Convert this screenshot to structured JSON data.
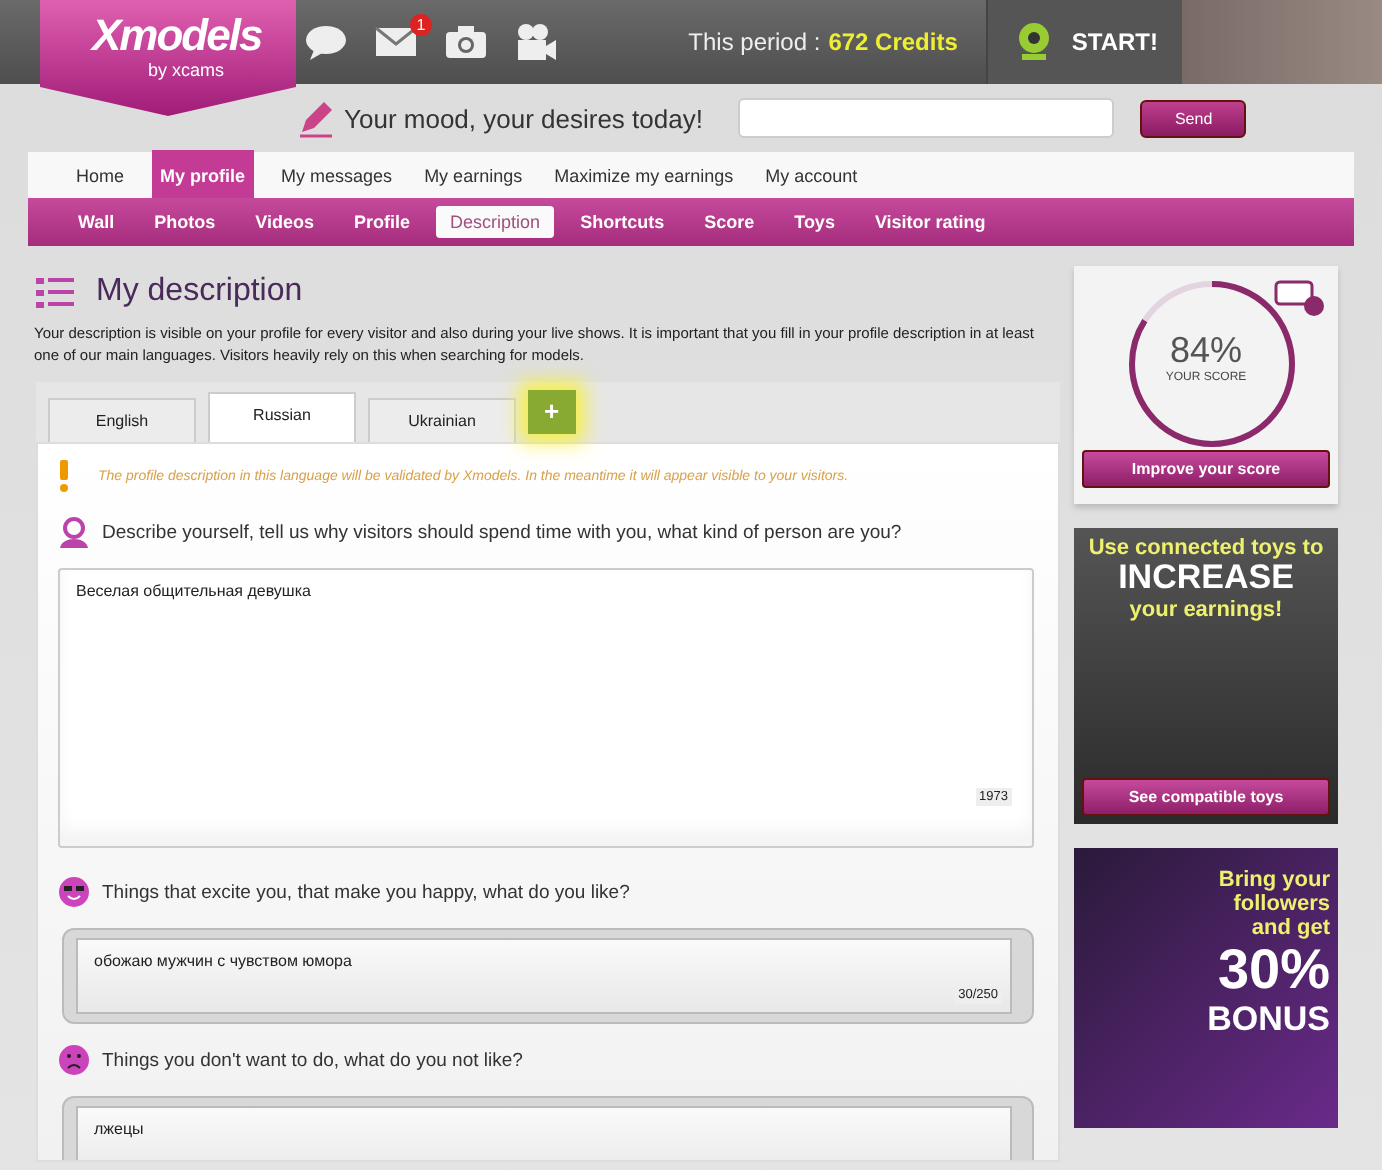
{
  "header": {
    "logo": {
      "title": "Xmodels",
      "subtitle": "by xcams"
    },
    "mail_badge": "1",
    "period_label": "This period :",
    "credits": "672 Credits",
    "start": "START!"
  },
  "mood": {
    "label": "Your mood, your desires today!",
    "send": "Send"
  },
  "nav": [
    {
      "label": "Home",
      "selected": false
    },
    {
      "label": "My profile",
      "selected": true
    },
    {
      "label": "My messages",
      "selected": false
    },
    {
      "label": "My earnings",
      "selected": false
    },
    {
      "label": "Maximize my earnings",
      "selected": false
    },
    {
      "label": "My account",
      "selected": false
    }
  ],
  "subnav": [
    {
      "label": "Wall",
      "selected": false
    },
    {
      "label": "Photos",
      "selected": false
    },
    {
      "label": "Videos",
      "selected": false
    },
    {
      "label": "Profile",
      "selected": false
    },
    {
      "label": "Description",
      "selected": true
    },
    {
      "label": "Shortcuts",
      "selected": false
    },
    {
      "label": "Score",
      "selected": false
    },
    {
      "label": "Toys",
      "selected": false
    },
    {
      "label": "Visitor rating",
      "selected": false
    }
  ],
  "page": {
    "title": "My description",
    "intro": "Your description is visible on your profile for every visitor and also during your live shows. It is important that you fill in your profile description in at least one of our main languages. Visitors heavily rely on this when searching for models."
  },
  "language_tabs": [
    {
      "label": "English",
      "selected": false
    },
    {
      "label": "Russian",
      "selected": true
    },
    {
      "label": "Ukrainian",
      "selected": false
    }
  ],
  "add_tab": "+",
  "notice": "The profile description in this language will be validated by Xmodels. In the meantime it will appear visible to your visitors.",
  "questions": [
    {
      "kind": "main",
      "question": "Describe yourself, tell us why visitors should spend time with you, what kind of person are you?",
      "answer": "Веселая общительная девушка",
      "counter": "1973"
    },
    {
      "kind": "bubble",
      "question": "Things that excite you, that make you happy, what do you like?",
      "answer": "обожаю мужчин с чувством юмора",
      "counter": "30/250"
    },
    {
      "kind": "bubble",
      "question": "Things you don't want to do, what do you not like?",
      "answer": "лжецы"
    }
  ],
  "score": {
    "value": "84%",
    "label": "YOUR SCORE",
    "level": 0.84,
    "button": "Improve your score"
  },
  "ads": [
    {
      "kind": "toys",
      "lines": [
        {
          "text": "Use connected toys to",
          "kind": "accent"
        },
        {
          "text": "INCREASE",
          "kind": "big"
        },
        {
          "text": "your earnings!",
          "kind": "accent"
        }
      ],
      "button": "See compatible toys"
    },
    {
      "kind": "bonus",
      "lines": [
        {
          "text": "Bring your",
          "kind": "accent"
        },
        {
          "text": "followers",
          "kind": "accent"
        },
        {
          "text": "and get",
          "kind": "accent"
        },
        {
          "text": "30%",
          "kind": "huge"
        },
        {
          "text": "BONUS",
          "kind": "big"
        }
      ]
    }
  ]
}
